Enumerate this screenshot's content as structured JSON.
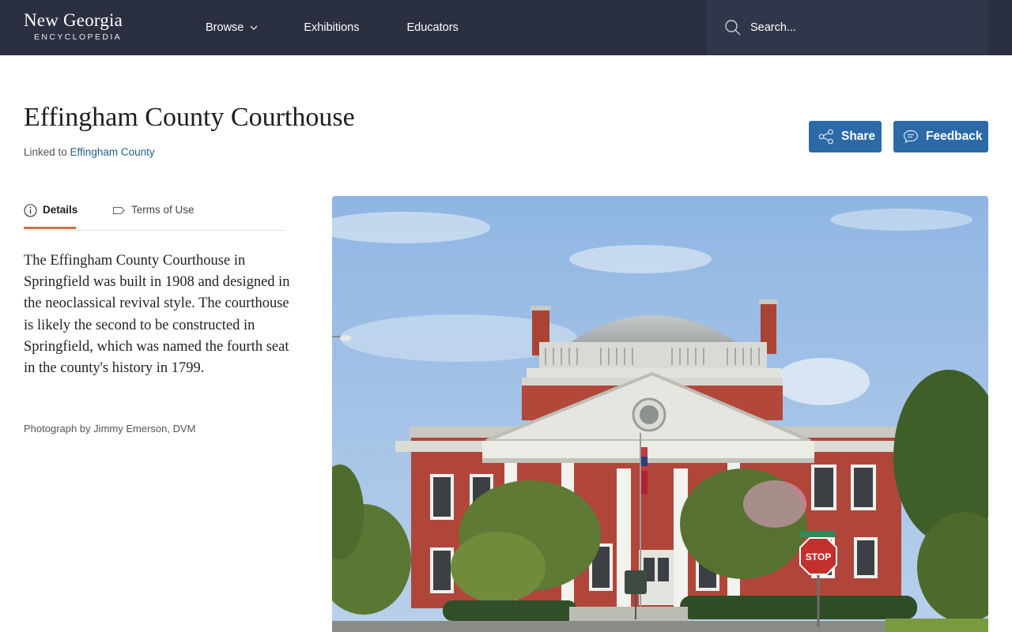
{
  "header": {
    "logo_title": "New Georgia",
    "logo_subtitle": "ENCYCLOPEDIA",
    "nav": {
      "browse": "Browse",
      "exhibitions": "Exhibitions",
      "educators": "Educators"
    },
    "search_placeholder": "Search..."
  },
  "page": {
    "title": "Effingham County Courthouse",
    "linked_prefix": "Linked to ",
    "linked_link": "Effingham County"
  },
  "actions": {
    "share": "Share",
    "feedback": "Feedback"
  },
  "tabs": {
    "details": "Details",
    "terms": "Terms of Use"
  },
  "description": "The Effingham County Courthouse in Springfield was built in 1908 and designed in the neoclassical revival style. The courthouse is likely the second to be constructed in Springfield, which was named the fourth seat in the county's history in 1799.",
  "credit": "Photograph by Jimmy Emerson, DVM",
  "photo": {
    "stop_sign_text": "STOP"
  },
  "colors": {
    "header_bg": "#2b3041",
    "button_bg": "#2b6aa6",
    "link": "#1f5f8b",
    "tab_accent": "#c8744c"
  }
}
